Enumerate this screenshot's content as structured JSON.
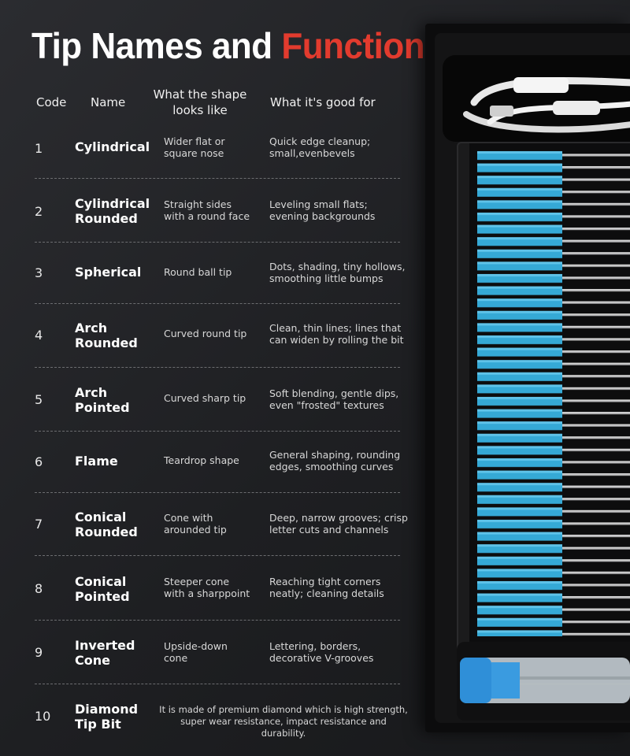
{
  "title": {
    "part1": "Tip Names and",
    "part2": "Functions"
  },
  "header": {
    "code": "Code",
    "name": "Name",
    "shape_line1": "What the shape",
    "shape_line2": "looks like",
    "good": "What it's good for"
  },
  "rows": [
    {
      "code": "1",
      "name1": "Cylindrical",
      "name2": "",
      "shape1": "Wider flat or",
      "shape2": "square nose",
      "good1": "Quick edge cleanup;",
      "good2": "small,evenbevels"
    },
    {
      "code": "2",
      "name1": "Cylindrical",
      "name2": "Rounded",
      "shape1": "Straight sides",
      "shape2": "with a round face",
      "good1": "Leveling small flats;",
      "good2": "evening backgrounds"
    },
    {
      "code": "3",
      "name1": "Spherical",
      "name2": "",
      "shape1": "Round ball tip",
      "shape2": "",
      "good1": "Dots, shading, tiny hollows,",
      "good2": "smoothing little bumps"
    },
    {
      "code": "4",
      "name1": "Arch",
      "name2": "Rounded",
      "shape1": "Curved round tip",
      "shape2": "",
      "good1": "Clean, thin lines; lines that",
      "good2": "can widen by rolling the bit"
    },
    {
      "code": "5",
      "name1": "Arch",
      "name2": "Pointed",
      "shape1": "Curved sharp tip",
      "shape2": "",
      "good1": "Soft blending, gentle dips,",
      "good2": "even \"frosted\" textures"
    },
    {
      "code": "6",
      "name1": "Flame",
      "name2": "",
      "shape1": "Teardrop shape",
      "shape2": "",
      "good1": "General shaping, rounding",
      "good2": "edges, smoothing curves"
    },
    {
      "code": "7",
      "name1": "Conical",
      "name2": "Rounded",
      "shape1": "Cone with",
      "shape2": "arounded tip",
      "good1": "Deep, narrow grooves; crisp",
      "good2": "letter cuts and channels"
    },
    {
      "code": "8",
      "name1": "Conical",
      "name2": "Pointed",
      "shape1": "Steeper cone",
      "shape2": "with a sharppoint",
      "good1": "Reaching tight corners",
      "good2": "neatly; cleaning details"
    },
    {
      "code": "9",
      "name1": "Inverted",
      "name2": "Cone",
      "shape1": "Upside-down",
      "shape2": "cone",
      "good1": "Lettering, borders,",
      "good2": "decorative V-grooves"
    }
  ],
  "last_row": {
    "code": "10",
    "name1": "Diamond",
    "name2": "Tip Bit",
    "desc1": "It is made of premium diamond which is high strength,",
    "desc2": "super wear resistance, impact resistance and durability."
  },
  "colors": {
    "accent_red": "#e23b2e",
    "handle_blue": "#35a9d6",
    "background": "#232427"
  }
}
